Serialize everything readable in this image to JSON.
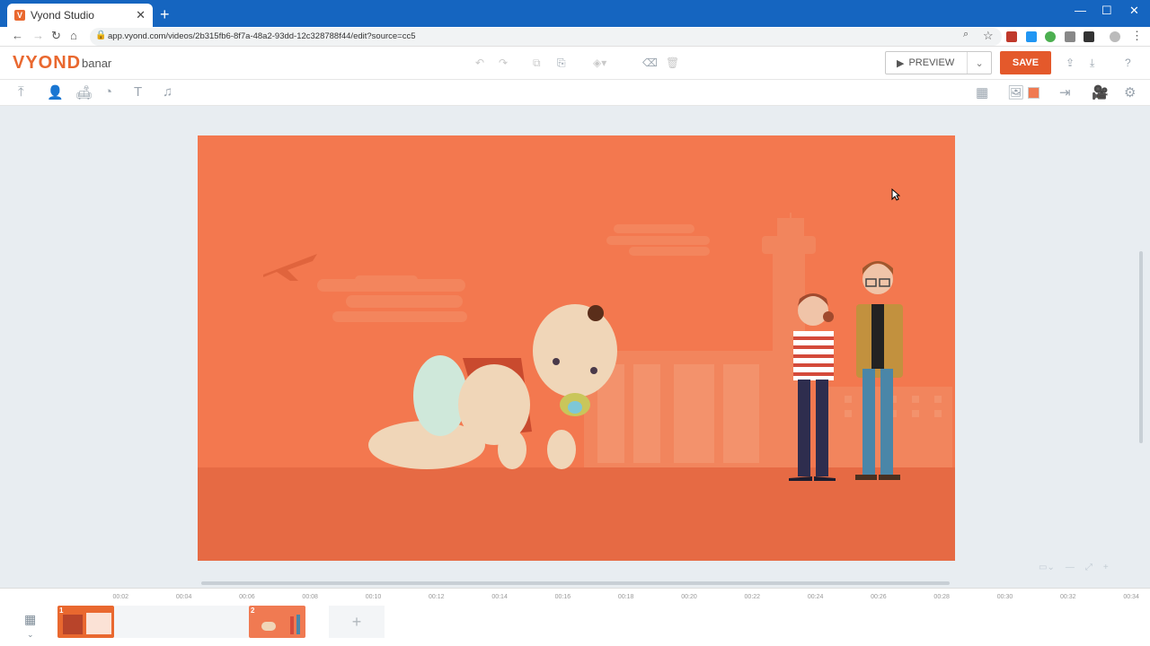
{
  "browser": {
    "tab_title": "Vyond Studio",
    "tab_favicon": "V",
    "url": "app.vyond.com/videos/2b315fb6-8f7a-48a2-93dd-12c328788f44/edit?source=cc5"
  },
  "app": {
    "logo": "VYOND",
    "project_name": "banar",
    "preview_label": "PREVIEW",
    "save_label": "SAVE",
    "accent": "#e4592b"
  },
  "scene": {
    "background_color": "#f3784f",
    "ground_color": "#e66a44"
  },
  "timeline": {
    "ticks": [
      "00:02",
      "00:04",
      "00:06",
      "00:08",
      "00:10",
      "00:12",
      "00:14",
      "00:16",
      "00:18",
      "00:20",
      "00:22",
      "00:24",
      "00:26",
      "00:28",
      "00:30",
      "00:32",
      "00:34"
    ],
    "scenes": [
      {
        "number": "1"
      },
      {
        "number": "2"
      }
    ],
    "add_label": "+"
  }
}
